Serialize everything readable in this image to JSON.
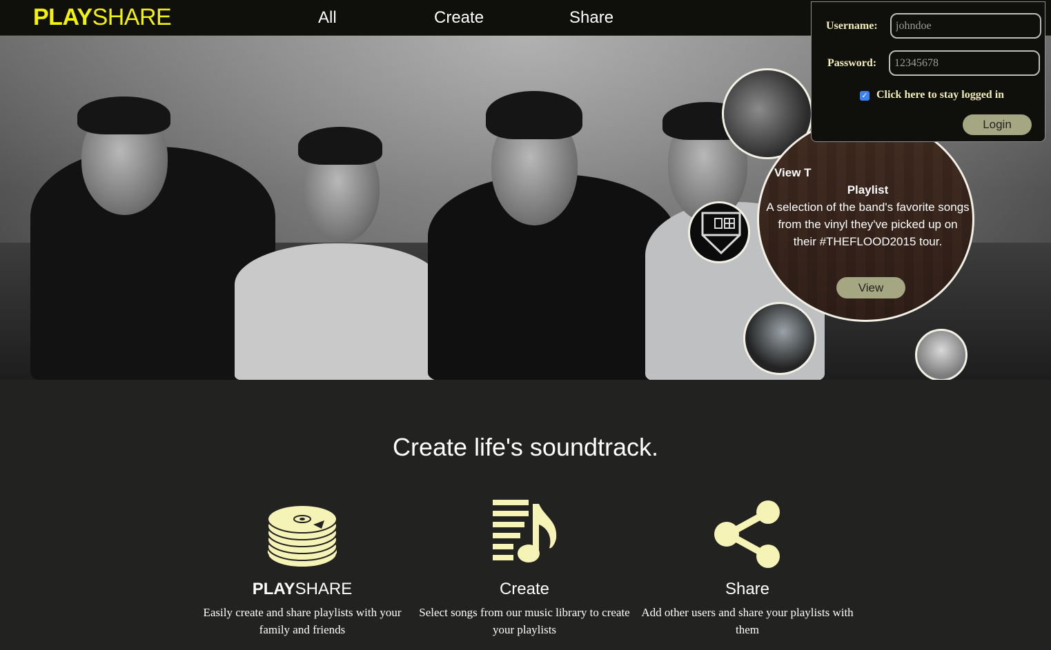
{
  "brand": {
    "bold": "PLAY",
    "regular": "SHARE"
  },
  "nav": {
    "all": "All",
    "create": "Create",
    "share": "Share"
  },
  "login": {
    "username_label": "Username:",
    "username_value": "johndoe",
    "password_label": "Password:",
    "password_value": "12345678",
    "remember_checked": true,
    "remember_label": "Click here to stay logged in",
    "login_button": "Login"
  },
  "featured": {
    "title_partial": "View T",
    "title_line2": "Playlist",
    "description": "A selection of the band's favorite songs from the vinyl they've picked up on their #THEFLOOD2015 tour.",
    "view_button": "View"
  },
  "tagline": "Create life's soundtrack.",
  "features": [
    {
      "icon": "disc-stack-icon",
      "name_bold": "PLAY",
      "name_regular": "SHARE",
      "description": "Easily create and share playlists with your family and friends"
    },
    {
      "icon": "playlist-icon",
      "name": "Create",
      "description": "Select songs from our music library to create your playlists"
    },
    {
      "icon": "share-icon",
      "name": "Share",
      "description": "Add other users and share your playlists with them"
    }
  ],
  "colors": {
    "brand_yellow": "#f2f20a",
    "icon_cream": "#f6f3b6",
    "button_olive": "#a5a682",
    "background": "#222220"
  }
}
